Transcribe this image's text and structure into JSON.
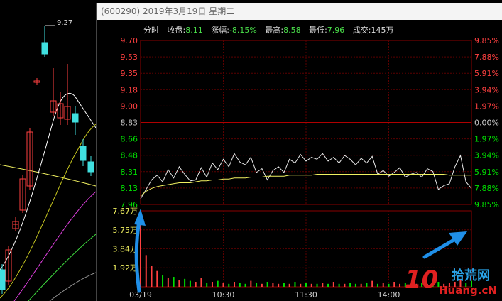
{
  "popup": {
    "title": "(600290) 2019年3月19日 星期二"
  },
  "info": {
    "mode": "分时",
    "close_label": "收盘:",
    "close": "8.11",
    "change_label": "涨幅:",
    "change": "-8.15%",
    "high_label": "最高:",
    "high": "8.58",
    "low_label": "最低:",
    "low": "7.96",
    "volume_label": "成交:",
    "volume": "145万"
  },
  "kline": {
    "high_label": "9.27"
  },
  "colors": {
    "up": "#ff4040",
    "down": "#00e000",
    "neutral": "#cccccc",
    "price_line": "#e8e8e8",
    "avg_line": "#f0f060",
    "volume_axis": "#f0f060",
    "arrow": "#1f8fe8"
  },
  "chart_data": {
    "type": "line",
    "title": "",
    "xlabel": "",
    "ylabel": "",
    "price_ticks_left": [
      "9.70",
      "9.53",
      "9.35",
      "9.18",
      "9.00",
      "8.83",
      "8.66",
      "8.48",
      "8.31",
      "8.13",
      "7.96"
    ],
    "pct_ticks_right": [
      "9.85%",
      "7.88%",
      "5.91%",
      "3.94%",
      "1.97%",
      "0.00%",
      "1.97%",
      "3.94%",
      "5.91%",
      "7.88%",
      "9.85%"
    ],
    "ylim": [
      7.96,
      9.7
    ],
    "x_ticks": [
      "03/19",
      "10:30",
      "11:30",
      "14:00"
    ],
    "volume_ticks": [
      "7.67万",
      "5.75万",
      "3.84万",
      "1.92万"
    ],
    "volume_ylim": [
      0,
      7.67
    ],
    "x": [
      0,
      4,
      8,
      12,
      16,
      20,
      24,
      28,
      32,
      36,
      40,
      44,
      48,
      52,
      56,
      60,
      64,
      68,
      72,
      76,
      80,
      84,
      88,
      92,
      96,
      100,
      104,
      108,
      112,
      116,
      120,
      124,
      128,
      132,
      136,
      140,
      144,
      148,
      152,
      156,
      160,
      164,
      168,
      172,
      176,
      180,
      184,
      188,
      192,
      196,
      200,
      204,
      208,
      212,
      216,
      220,
      224,
      228,
      232,
      236,
      240
    ],
    "series": [
      {
        "values": [
          8.02,
          8.12,
          8.22,
          8.27,
          8.2,
          8.33,
          8.24,
          8.36,
          8.28,
          8.21,
          8.22,
          8.35,
          8.25,
          8.4,
          8.33,
          8.44,
          8.36,
          8.5,
          8.41,
          8.38,
          8.46,
          8.3,
          8.34,
          8.22,
          8.32,
          8.36,
          8.3,
          8.44,
          8.4,
          8.49,
          8.42,
          8.46,
          8.44,
          8.5,
          8.42,
          8.46,
          8.4,
          8.48,
          8.44,
          8.38,
          8.45,
          8.4,
          8.47,
          8.28,
          8.32,
          8.26,
          8.3,
          8.35,
          8.25,
          8.28,
          8.3,
          8.25,
          8.34,
          8.31,
          8.12,
          8.16,
          8.18,
          8.36,
          8.48,
          8.2,
          8.13
        ]
      },
      {
        "values": [
          8.05,
          8.1,
          8.13,
          8.15,
          8.16,
          8.17,
          8.18,
          8.19,
          8.19,
          8.19,
          8.2,
          8.21,
          8.21,
          8.22,
          8.22,
          8.23,
          8.23,
          8.24,
          8.24,
          8.24,
          8.25,
          8.25,
          8.25,
          8.26,
          8.26,
          8.26,
          8.26,
          8.27,
          8.27,
          8.27,
          8.27,
          8.27,
          8.28,
          8.28,
          8.28,
          8.28,
          8.28,
          8.28,
          8.28,
          8.28,
          8.28,
          8.28,
          8.28,
          8.28,
          8.28,
          8.28,
          8.28,
          8.28,
          8.28,
          8.28,
          8.28,
          8.28,
          8.28,
          8.28,
          8.28,
          8.28,
          8.27,
          8.27,
          8.27,
          8.27,
          8.27
        ]
      }
    ],
    "volume": [
      7.5,
      3.2,
      2.1,
      1.6,
      1.2,
      0.9,
      1.0,
      0.7,
      0.8,
      0.6,
      0.5,
      0.9,
      0.4,
      0.5,
      0.6,
      0.4,
      0.3,
      0.5,
      0.4,
      0.3,
      0.6,
      0.4,
      0.3,
      0.5,
      0.4,
      0.3,
      0.4,
      0.3,
      0.5,
      0.3,
      0.4,
      0.3,
      0.3,
      0.4,
      0.3,
      0.5,
      0.3,
      0.3,
      0.4,
      0.3,
      0.3,
      0.4,
      0.6,
      0.3,
      0.4,
      0.3,
      0.5,
      0.3,
      0.4,
      0.3,
      0.3,
      0.4,
      0.3,
      0.4,
      0.5,
      0.3,
      0.4,
      0.5,
      0.8,
      0.4,
      0.6
    ]
  },
  "watermark": {
    "number": "10",
    "cn": "拾荒网",
    "en": "Huang.cN"
  }
}
